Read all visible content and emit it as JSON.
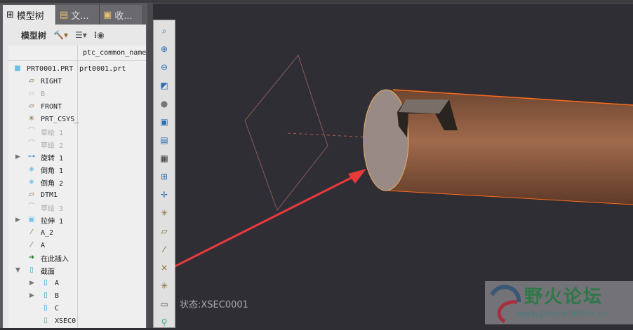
{
  "tabs": [
    {
      "label": "模型树"
    },
    {
      "label": "文..."
    },
    {
      "label": "收..."
    }
  ],
  "panel_title": "模型树",
  "column_header": "ptc_common_name",
  "tree": [
    {
      "label": "PRT0001.PRT",
      "value": "prt0001.prt",
      "icon": "part-icon",
      "indent": 0,
      "dim": false,
      "expander": ""
    },
    {
      "label": "RIGHT",
      "icon": "datum-plane-icon",
      "indent": 1,
      "dim": false,
      "expander": ""
    },
    {
      "label": "B",
      "icon": "datum-plane-icon",
      "indent": 1,
      "dim": true,
      "expander": ""
    },
    {
      "label": "FRONT",
      "icon": "datum-plane-icon",
      "indent": 1,
      "dim": false,
      "expander": ""
    },
    {
      "label": "PRT_CSYS_",
      "icon": "csys-icon",
      "indent": 1,
      "dim": false,
      "expander": ""
    },
    {
      "label": "草绘 1",
      "icon": "sketch-icon",
      "indent": 1,
      "dim": true,
      "expander": ""
    },
    {
      "label": "草绘 2",
      "icon": "sketch-icon",
      "indent": 1,
      "dim": true,
      "expander": ""
    },
    {
      "label": "旋转 1",
      "icon": "revolve-icon",
      "indent": 1,
      "dim": false,
      "expander": "▶"
    },
    {
      "label": "倒角 1",
      "icon": "chamfer-icon",
      "indent": 1,
      "dim": false,
      "expander": ""
    },
    {
      "label": "倒角 2",
      "icon": "chamfer-icon",
      "indent": 1,
      "dim": false,
      "expander": ""
    },
    {
      "label": "DTM1",
      "icon": "datum-plane-icon",
      "indent": 1,
      "dim": false,
      "expander": ""
    },
    {
      "label": "草绘 3",
      "icon": "sketch-icon",
      "indent": 1,
      "dim": true,
      "expander": ""
    },
    {
      "label": "拉伸 1",
      "icon": "extrude-icon",
      "indent": 1,
      "dim": false,
      "expander": "▶"
    },
    {
      "label": "A_2",
      "icon": "axis-icon",
      "indent": 1,
      "dim": false,
      "expander": ""
    },
    {
      "label": "A",
      "icon": "axis-icon",
      "indent": 1,
      "dim": false,
      "expander": ""
    },
    {
      "label": "在此插入",
      "icon": "insert-here-icon",
      "indent": 1,
      "dim": false,
      "expander": ""
    },
    {
      "label": "截面",
      "icon": "section-icon",
      "indent": 1,
      "dim": false,
      "expander": "▼"
    },
    {
      "label": "A",
      "icon": "section-icon",
      "indent": 2,
      "dim": false,
      "expander": "▶"
    },
    {
      "label": "B",
      "icon": "section-icon",
      "indent": 2,
      "dim": false,
      "expander": "▶"
    },
    {
      "label": "C",
      "icon": "section-icon",
      "indent": 2,
      "dim": false,
      "expander": ""
    },
    {
      "label": "XSEC0",
      "icon": "section-active-icon",
      "indent": 2,
      "dim": false,
      "expander": ""
    }
  ],
  "viewport_status": "状态:XSEC0001",
  "watermark": {
    "title": "野火论坛",
    "url": "www.proewildfire.cn"
  },
  "colors": {
    "viewport_bg": "#2f2e35",
    "cylinder": "#8a5a40",
    "edge": "#ff6a1a",
    "arrow": "#e83a3a"
  }
}
